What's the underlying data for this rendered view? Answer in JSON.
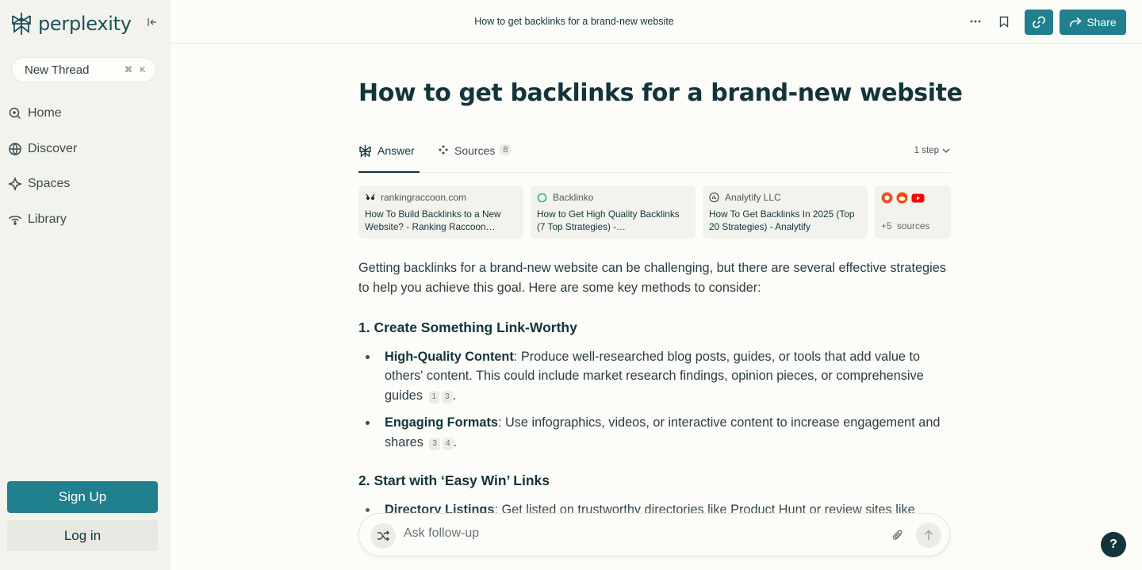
{
  "brand": {
    "name": "perplexity",
    "accent": "#20808d"
  },
  "sidebar": {
    "new_thread": {
      "label": "New Thread",
      "shortcut": [
        "⌘",
        "K"
      ]
    },
    "items": [
      {
        "label": "Home",
        "icon": "search-icon"
      },
      {
        "label": "Discover",
        "icon": "globe-icon"
      },
      {
        "label": "Spaces",
        "icon": "spaces-icon"
      },
      {
        "label": "Library",
        "icon": "library-icon"
      }
    ],
    "signup_label": "Sign Up",
    "login_label": "Log in"
  },
  "topbar": {
    "title": "How to get backlinks for a brand-new website",
    "share_label": "Share"
  },
  "thread": {
    "title": "How to get backlinks for a brand-new website",
    "tabs": {
      "answer": "Answer",
      "sources": "Sources",
      "sources_count": "8"
    },
    "steps": "1 step"
  },
  "sources": [
    {
      "site": "rankingraccoon.com",
      "title": "How To Build Backlinks to a New Website? - Ranking Raccoon…"
    },
    {
      "site": "Backlinko",
      "title": "How to Get High Quality Backlinks (7 Top Strategies) -…"
    },
    {
      "site": "Analytify LLC",
      "title": "How To Get Backlinks In 2025 (Top 20 Strategies) - Analytify"
    }
  ],
  "more_sources": {
    "count": "+5",
    "label": "sources"
  },
  "answer": {
    "intro": "Getting backlinks for a brand-new website can be challenging, but there are several effective strategies to help you achieve this goal. Here are some key methods to consider:",
    "sections": [
      {
        "heading": "1. Create Something Link-Worthy",
        "bullets": [
          {
            "bold": "High-Quality Content",
            "text": ": Produce well-researched blog posts, guides, or tools that add value to others' content. This could include market research findings, opinion pieces, or comprehensive guides",
            "cites": [
              "1",
              "3"
            ],
            "end": "."
          },
          {
            "bold": "Engaging Formats",
            "text": ": Use infographics, videos, or interactive content to increase engagement and shares",
            "cites": [
              "3",
              "4"
            ],
            "end": "."
          }
        ]
      },
      {
        "heading": "2. Start with ‘Easy Win’ Links",
        "bullets": [
          {
            "bold": "Directory Listings",
            "text": ": Get listed on trustworthy directories like Product Hunt or review sites like",
            "cites": [],
            "end": ""
          }
        ]
      }
    ]
  },
  "followup": {
    "placeholder": "Ask follow-up"
  },
  "help_label": "?"
}
